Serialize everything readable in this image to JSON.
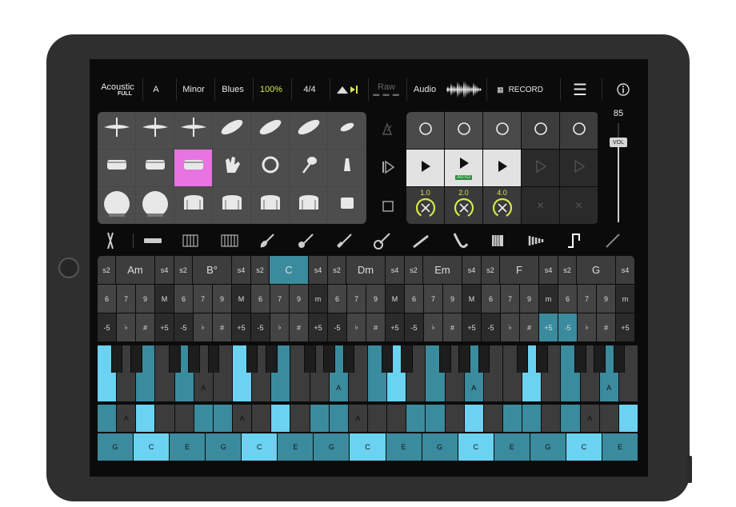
{
  "topbar": {
    "preset_line1": "Acoustic",
    "preset_line2": "FULL",
    "key": "A",
    "mode": "Minor",
    "style": "Blues",
    "tempo": "100%",
    "meter": "4/4",
    "raw": "Raw",
    "audio": "Audio",
    "record": "RECORD"
  },
  "volume": {
    "value": "85",
    "label": "VOL",
    "level": 0.78
  },
  "colors": {
    "accent": "#6bd2f2",
    "mid": "#3b8b9e",
    "drum_active": "#e774e0",
    "tempo": "#d6e84a"
  },
  "drums": {
    "rows": [
      [
        "cymbal",
        "cymbal",
        "cymbal",
        "cymbal-tilt",
        "cymbal-tilt",
        "cymbal-tilt",
        "cymbal-small"
      ],
      [
        "snare",
        "snare",
        "snare",
        "hand-clap",
        "tambourine",
        "maracas",
        "cowbell"
      ],
      [
        "kick",
        "kick",
        "tom",
        "tom",
        "tom",
        "tom",
        "tom-small"
      ]
    ],
    "active": {
      "row": 1,
      "col": 2
    }
  },
  "player": {
    "speeds": [
      "1.0",
      "2.0",
      "4.0"
    ],
    "auto": "AUTO"
  },
  "instruments": [
    "drum-sticks",
    "bass",
    "piano",
    "organ",
    "violin",
    "acoustic-guitar",
    "electric-guitar",
    "banjo",
    "clarinet",
    "saxophone",
    "accordion",
    "marimba",
    "step",
    "ramp"
  ],
  "chords": [
    {
      "name": "Am",
      "row1": [
        "6",
        "7",
        "9",
        "M"
      ],
      "selected": false
    },
    {
      "name": "B°",
      "row1": [
        "6",
        "7",
        "9",
        "M"
      ],
      "selected": false
    },
    {
      "name": "C",
      "row1": [
        "6",
        "7",
        "9",
        "m"
      ],
      "selected": true
    },
    {
      "name": "Dm",
      "row1": [
        "6",
        "7",
        "9",
        "M"
      ],
      "selected": false
    },
    {
      "name": "Em",
      "row1": [
        "6",
        "7",
        "9",
        "M"
      ],
      "selected": false
    },
    {
      "name": "F",
      "row1": [
        "6",
        "7",
        "9",
        "m"
      ],
      "selected": false
    },
    {
      "name": "G",
      "row1": [
        "6",
        "7",
        "9",
        "m"
      ],
      "selected": false
    }
  ],
  "chord_mods": {
    "left": "s2",
    "right": "s4",
    "row2": [
      "-5",
      "♭",
      "#",
      "+5"
    ]
  },
  "keyboard": {
    "upper_label": "A",
    "bottom_notes": [
      "G",
      "C",
      "E",
      "G",
      "C",
      "E",
      "G",
      "C",
      "E",
      "G",
      "C",
      "E",
      "G",
      "C",
      "E"
    ]
  }
}
